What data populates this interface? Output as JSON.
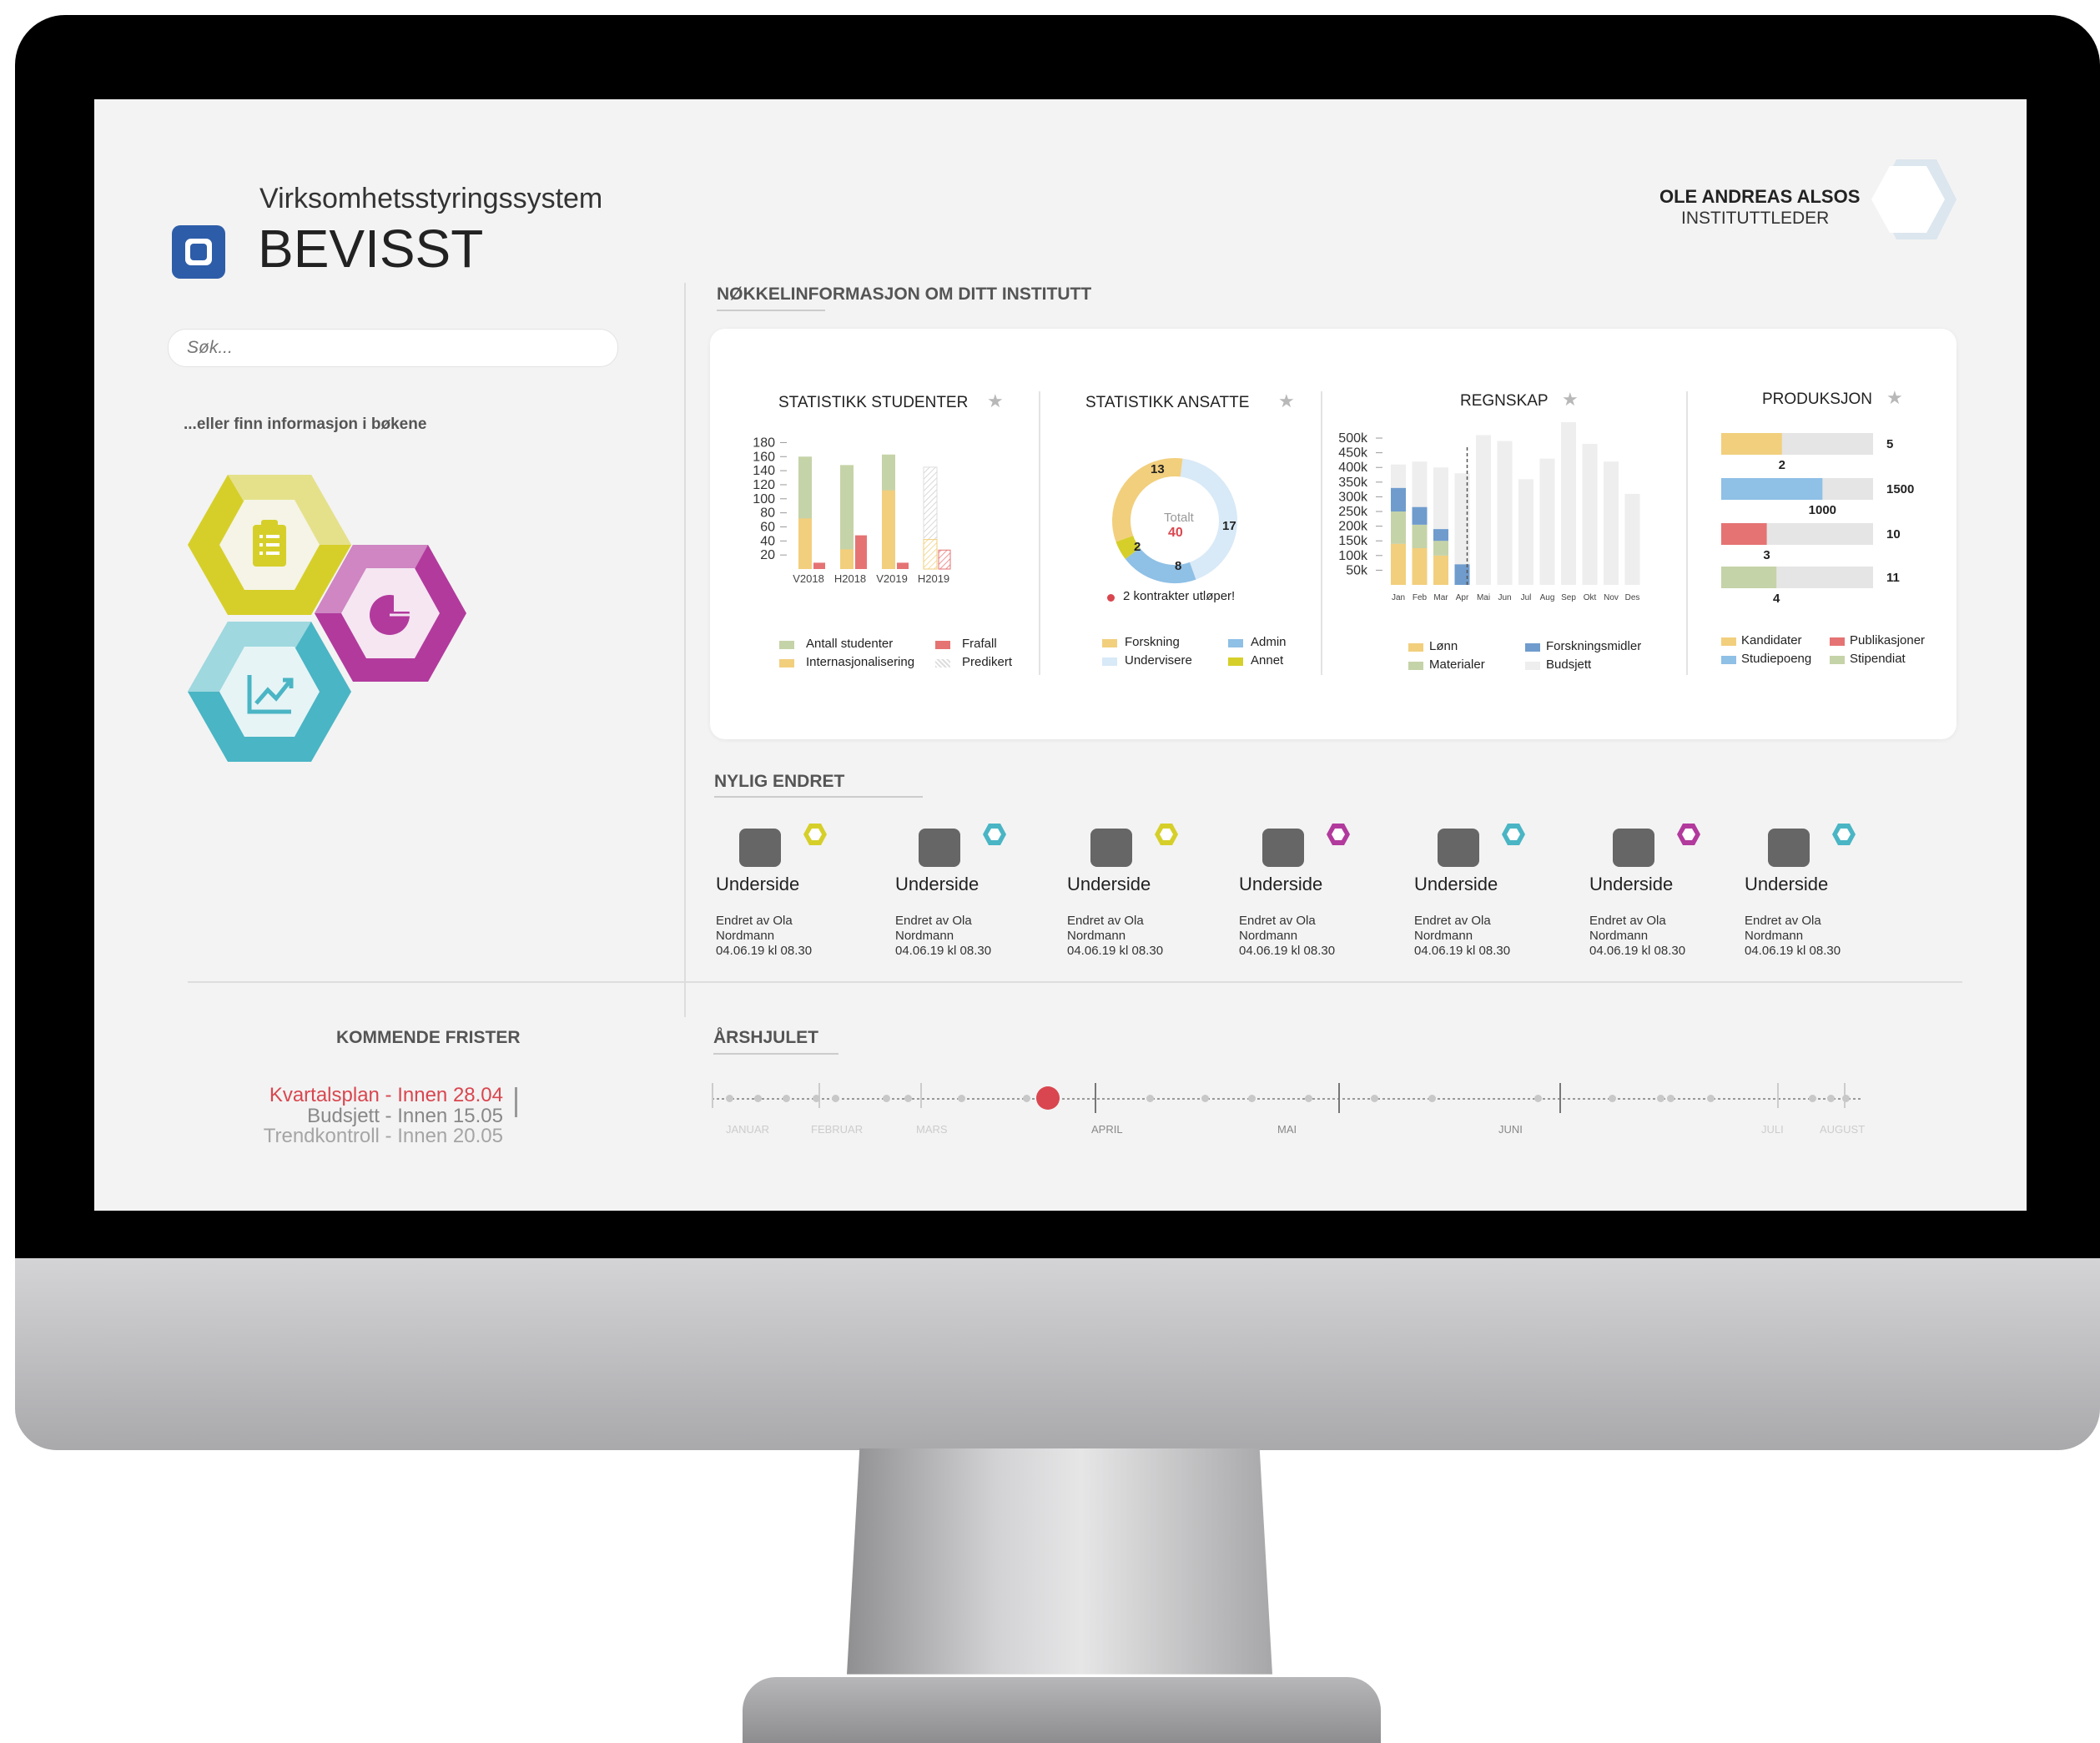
{
  "app": {
    "subtitle": "Virksomhetsstyringssystem",
    "name": "BEVISST"
  },
  "user": {
    "name": "OLE ANDREAS ALSOS",
    "role": "INSTITUTTLEDER"
  },
  "search": {
    "placeholder": "Søk..."
  },
  "books_hint": "...eller finn informasjon i bøkene",
  "colors": {
    "accent_red": "#d9464f",
    "yellow": "#f2cf7d",
    "green": "#c5d3a8",
    "blue": "#8fc0e6",
    "lightblue": "#d8e9f7",
    "lime": "#d6cf2a",
    "magenta": "#b23a9d",
    "teal": "#4ab5c4",
    "brand_blue": "#2d5da9"
  },
  "book_icons": [
    "clipboard-icon",
    "pie-chart-icon",
    "trend-up-icon"
  ],
  "key_info": {
    "heading": "NØKKELINFORMASJON OM DITT INSTITUTT",
    "students": {
      "title": "STATISTIKK STUDENTER",
      "legend": [
        "Antall studenter",
        "Frafall",
        "Internasjonalisering",
        "Predikert"
      ]
    },
    "staff": {
      "title": "STATISTIKK ANSATTE",
      "center_label": "Totalt",
      "center_value": "40",
      "labels": [
        "13",
        "17",
        "8",
        "2"
      ],
      "note": "2 kontrakter utløper!",
      "legend": [
        "Forskning",
        "Admin",
        "Undervisere",
        "Annet"
      ]
    },
    "accounts": {
      "title": "REGNSKAP",
      "legend": [
        "Lønn",
        "Forskningsmidler",
        "Materialer",
        "Budsjett"
      ]
    },
    "production": {
      "title": "PRODUKSJON",
      "legend": [
        "Kandidater",
        "Publikasjoner",
        "Studiepoeng",
        "Stipendiat"
      ]
    }
  },
  "chart_data": [
    {
      "type": "bar",
      "title": "STATISTIKK STUDENTER",
      "categories": [
        "V2018",
        "H2018",
        "V2019",
        "H2019"
      ],
      "ylim": [
        0,
        190
      ],
      "yticks": [
        "180",
        "160",
        "140",
        "120",
        "100",
        "80",
        "60",
        "40",
        "20"
      ],
      "series": [
        {
          "name": "Antall studenter",
          "values": [
            160,
            148,
            163,
            145
          ]
        },
        {
          "name": "Internasjonalisering",
          "values": [
            72,
            28,
            112,
            42
          ]
        },
        {
          "name": "Frafall",
          "values": [
            9,
            48,
            9,
            27
          ]
        },
        {
          "name": "Predikert",
          "values": [
            0,
            0,
            0,
            145
          ]
        }
      ]
    },
    {
      "type": "pie",
      "title": "STATISTIKK ANSATTE",
      "categories": [
        "Forskning",
        "Undervisere",
        "Admin",
        "Annet"
      ],
      "values": [
        13,
        17,
        8,
        2
      ],
      "total": 40
    },
    {
      "type": "bar",
      "title": "REGNSKAP",
      "categories": [
        "Jan",
        "Feb",
        "Mar",
        "Apr",
        "Mai",
        "Jun",
        "Jul",
        "Aug",
        "Sep",
        "Okt",
        "Nov",
        "Des"
      ],
      "yticks": [
        "500k",
        "450k",
        "400k",
        "350k",
        "300k",
        "250k",
        "200k",
        "150k",
        "100k",
        "50k"
      ],
      "ylim": [
        0,
        520000
      ],
      "series": [
        {
          "name": "Lønn",
          "values": [
            140000,
            125000,
            100000,
            0
          ]
        },
        {
          "name": "Materialer",
          "values": [
            110000,
            80000,
            50000,
            0
          ]
        },
        {
          "name": "Forskningsmidler",
          "values": [
            80000,
            60000,
            40000,
            70000
          ]
        },
        {
          "name": "Budsjett",
          "values": [
            410000,
            420000,
            400000,
            380000,
            510000,
            490000,
            360000,
            430000,
            570000,
            480000,
            420000,
            310000
          ]
        }
      ]
    },
    {
      "type": "bar",
      "title": "PRODUKSJON",
      "categories": [
        "Kandidater",
        "Studiepoeng",
        "Publikasjoner",
        "Stipendiat"
      ],
      "series": [
        {
          "name": "achieved",
          "values": [
            2,
            1000,
            3,
            4
          ]
        },
        {
          "name": "target",
          "values": [
            5,
            1500,
            10,
            11
          ]
        }
      ]
    }
  ],
  "recent": {
    "heading": "NYLIG ENDRET",
    "items": [
      {
        "title": "Underside",
        "by": "Endret av Ola",
        "name": "Nordmann",
        "date": "04.06.19 kl 08.30",
        "icon": "award-icon"
      },
      {
        "title": "Underside",
        "by": "Endret av Ola",
        "name": "Nordmann",
        "date": "04.06.19 kl 08.30",
        "icon": "sort-icon"
      },
      {
        "title": "Underside",
        "by": "Endret av Ola",
        "name": "Nordmann",
        "date": "04.06.19 kl 08.30",
        "icon": "teaching-screen-icon"
      },
      {
        "title": "Underside",
        "by": "Endret av Ola",
        "name": "Nordmann",
        "date": "04.06.19 kl 08.30",
        "icon": "group-icon"
      },
      {
        "title": "Underside",
        "by": "Endret av Ola",
        "name": "Nordmann",
        "date": "04.06.19 kl 08.30",
        "icon": "handshake-icon"
      },
      {
        "title": "Underside",
        "by": "Endret av Ola",
        "name": "Nordmann",
        "date": "04.06.19 kl 08.30",
        "icon": "cycle-check-icon"
      },
      {
        "title": "Underside",
        "by": "Endret av Ola",
        "name": "Nordmann",
        "date": "04.06.19 kl 08.30",
        "icon": "handshake-icon"
      }
    ]
  },
  "deadlines": {
    "heading": "KOMMENDE FRISTER",
    "items": [
      {
        "text": "Kvartalsplan - Innen 28.04",
        "color": "#d9464f"
      },
      {
        "text": "Budsjett - Innen 15.05",
        "color": "#888888"
      },
      {
        "text": "Trendkontroll - Innen 20.05",
        "color": "#a5a5a5"
      }
    ]
  },
  "timeline": {
    "heading": "ÅRSHJULET",
    "months": [
      "JANUAR",
      "FEBRUAR",
      "MARS",
      "APRIL",
      "MAI",
      "JUNI",
      "JULI",
      "AUGUST"
    ],
    "current": "APRIL"
  }
}
